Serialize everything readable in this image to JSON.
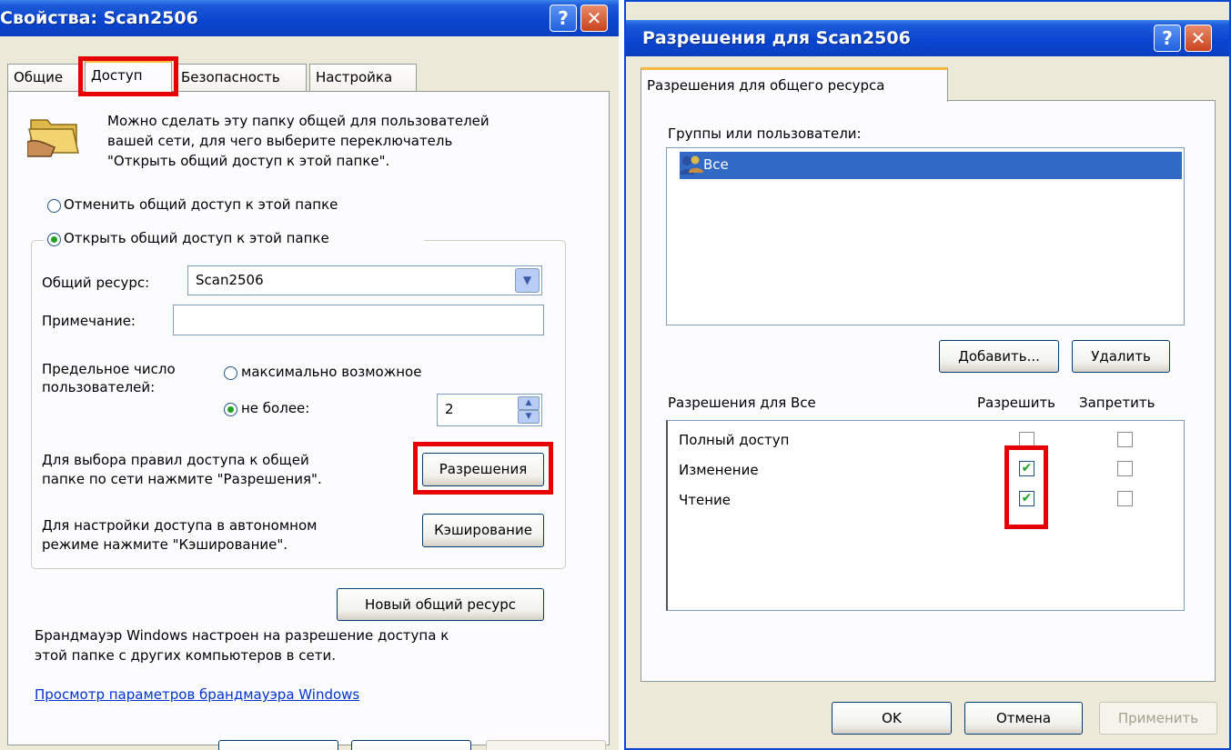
{
  "left_window": {
    "title": "Свойства: Scan2506",
    "help_glyph": "?",
    "close_glyph": "✕",
    "tabs": [
      "Общие",
      "Доступ",
      "Безопасность",
      "Настройка"
    ],
    "active_tab": "Доступ",
    "intro": [
      "Можно сделать эту папку общей для пользователей",
      "вашей сети, для чего выберите переключатель",
      "\"Открыть общий доступ к этой папке\"."
    ],
    "radio_unshare": "Отменить общий доступ к этой папке",
    "radio_share": "Открыть общий доступ к этой папке",
    "share_name_label": "Общий ресурс:",
    "share_name_value": "Scan2506",
    "comment_label": "Примечание:",
    "comment_value": "",
    "user_limit_label": [
      "Предельное число",
      "пользователей:"
    ],
    "radio_max": "максимально возможное",
    "radio_not_more": "не более:",
    "user_limit_value": "2",
    "permissions_hint": [
      "Для выбора правил доступа к общей",
      "папке по сети нажмите \"Разрешения\"."
    ],
    "permissions_button": "Разрешения",
    "caching_hint": [
      "Для настройки доступа в автономном",
      "режиме нажмите \"Кэширование\"."
    ],
    "caching_button": "Кэширование",
    "new_share_button": "Новый общий ресурс",
    "firewall_text": [
      "Брандмауэр Windows настроен на разрешение доступа к",
      "этой папке с других компьютеров в сети."
    ],
    "firewall_link": "Просмотр параметров брандмауэра Windows"
  },
  "right_window": {
    "title": "Разрешения для Scan2506",
    "help_glyph": "?",
    "close_glyph": "✕",
    "tab": "Разрешения для общего ресурса",
    "groups_label": "Группы или пользователи:",
    "groups": [
      {
        "name": "Все",
        "selected": true
      }
    ],
    "add_button": "Добавить...",
    "remove_button": "Удалить",
    "permissions_for_label": "Разрешения для Все",
    "allow_header": "Разрешить",
    "deny_header": "Запретить",
    "permissions": [
      {
        "name": "Полный доступ",
        "allow": false,
        "deny": false
      },
      {
        "name": "Изменение",
        "allow": true,
        "deny": false
      },
      {
        "name": "Чтение",
        "allow": true,
        "deny": false
      }
    ],
    "check_glyph": "✔",
    "ok_button": "OK",
    "cancel_button": "Отмена",
    "apply_button": "Применить"
  },
  "colors": {
    "title_bar": "#0a46d0",
    "highlight_red": "#e60000",
    "selection": "#316ac5",
    "dialog_bg": "#ece9d8"
  }
}
